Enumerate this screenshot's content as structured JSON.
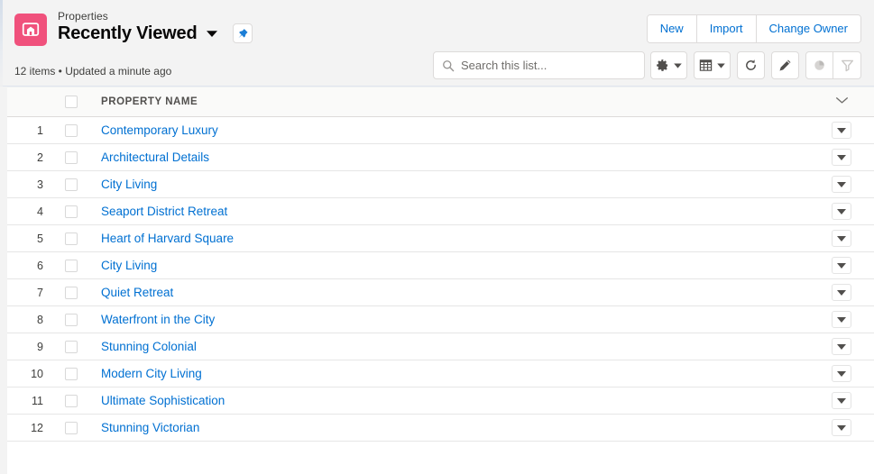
{
  "header": {
    "object_label": "Properties",
    "list_view_name": "Recently Viewed",
    "list_view_caret_icon": "chevron-down-icon",
    "pin_icon": "pin-icon",
    "object_icon": "property-house-sign-icon",
    "object_icon_color": "#f0517c",
    "meta": "12 items • Updated a minute ago",
    "actions": [
      {
        "label": "New",
        "name": "new-button"
      },
      {
        "label": "Import",
        "name": "import-button"
      },
      {
        "label": "Change Owner",
        "name": "change-owner-button"
      }
    ]
  },
  "search": {
    "placeholder": "Search this list...",
    "value": "",
    "icon": "search-icon"
  },
  "toolbar": {
    "buttons": [
      {
        "name": "list-view-controls-button",
        "icon": "gear-icon",
        "has_caret": true,
        "disabled": false
      },
      {
        "name": "display-as-button",
        "icon": "table-grid-icon",
        "has_caret": true,
        "disabled": false
      },
      {
        "name": "refresh-button",
        "icon": "refresh-icon",
        "has_caret": false,
        "disabled": false
      },
      {
        "name": "edit-button",
        "icon": "pencil-icon",
        "has_caret": false,
        "disabled": false
      },
      {
        "name": "charts-button",
        "icon": "pie-chart-icon",
        "has_caret": false,
        "disabled": true
      },
      {
        "name": "filter-button",
        "icon": "funnel-filter-icon",
        "has_caret": false,
        "disabled": true
      }
    ]
  },
  "table": {
    "columns": [
      {
        "key": "num",
        "label": ""
      },
      {
        "key": "check",
        "label": ""
      },
      {
        "key": "name",
        "label": "PROPERTY NAME"
      },
      {
        "key": "actions",
        "label": ""
      }
    ],
    "header_menu_icon": "chevron-down-icon",
    "row_menu_icon": "triangle-down-icon",
    "rows": [
      {
        "num": "1",
        "name": "Contemporary Luxury"
      },
      {
        "num": "2",
        "name": "Architectural Details"
      },
      {
        "num": "3",
        "name": "City Living"
      },
      {
        "num": "4",
        "name": "Seaport District Retreat"
      },
      {
        "num": "5",
        "name": "Heart of Harvard Square"
      },
      {
        "num": "6",
        "name": "City Living"
      },
      {
        "num": "7",
        "name": "Quiet Retreat"
      },
      {
        "num": "8",
        "name": "Waterfront in the City"
      },
      {
        "num": "9",
        "name": "Stunning Colonial"
      },
      {
        "num": "10",
        "name": "Modern City Living"
      },
      {
        "num": "11",
        "name": "Ultimate Sophistication"
      },
      {
        "num": "12",
        "name": "Stunning Victorian"
      }
    ]
  },
  "colors": {
    "link": "#0070d2",
    "brand_icon": "#f0517c",
    "page_bg": "#f3f3f3",
    "border": "#dddbda"
  }
}
